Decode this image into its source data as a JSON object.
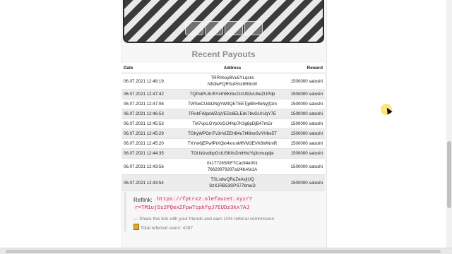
{
  "captcha": {
    "options": [
      "",
      "",
      "",
      ""
    ]
  },
  "section_title": "Recent Payouts",
  "table": {
    "headers": [
      "Date",
      "Address",
      "Reward"
    ],
    "rows": [
      {
        "date": "06.07.2021 12:48:19",
        "addr1": "TRRYeoyBVu5YLqsks",
        "addr2": "NN3wFQRSoPmz8R8cW",
        "reward": "1500000 satoshi"
      },
      {
        "date": "06.07.2021 12:47:42",
        "addr1": "TQPoiPL8U5Y4rh5Krbc2zzU92uUboZUPdp",
        "addr2": "",
        "reward": "1500000 satoshi"
      },
      {
        "date": "06.07.2021 12:47:06",
        "addr1": "TWSwCUddJNgYW9QETEETjpBhHfeNyjfj1m",
        "addr2": "",
        "reward": "1500000 satoshi"
      },
      {
        "date": "06.07.2021 12:46:53",
        "addr1": "TRohFr8peWZojVEDc6ELEdv7bvGUrUqY7E",
        "addr2": "",
        "reward": "1500000 satoshi"
      },
      {
        "date": "06.07.2021 12:45:53",
        "addr1": "TM7vjxLGYpiXrDiJ4Np7K3g8pDjB47mGr",
        "addr2": "",
        "reward": "1500000 satoshi"
      },
      {
        "date": "06.07.2021 12:45:29",
        "addr1": "TGhyWPGmTv3nViZEH84u7t48neSvYHbe5T",
        "addr2": "",
        "reward": "1500000 satoshi"
      },
      {
        "date": "06.07.2021 12:45:20",
        "addr1": "TXYw6jEPwfPtXQkr4xrunMfVM3EVK6WNmR",
        "addr2": "",
        "reward": "1500000 satoshi"
      },
      {
        "date": "06.07.2021 12:44:35",
        "addr1": "TGUidzvdbpGctUSKltsDntHbzYq3cmuqdje",
        "addr2": "",
        "reward": "1500000 satoshi"
      },
      {
        "date": "06.07.2021 12:43:56",
        "addr1": "0x17728Sf0F7Cac94e001",
        "addr2": "76629979287a1f4bAfa1A",
        "reward": "1500000 satoshi"
      },
      {
        "date": "06.07.2021 12:43:54",
        "addr1": "TSLsdwQRuZeAxjiUQ",
        "addr2": "SzXJRB53SPS77bmuD",
        "reward": "1500000 satoshi"
      }
    ]
  },
  "reflink": {
    "label": "Reflink:",
    "url_part1": "https://fptrx2.olefaucet.xyz/?",
    "url_part2": "r=TM1uj5s2PQexZFpwTcpkfgJ7EUDz3kx7AJ",
    "note": "— Share this link with your friends and earn 10% referral commission",
    "total": "Total referred users: 4287"
  },
  "colors": {
    "accent_link": "#c7254e",
    "title_gray": "#8f8f8f",
    "cursor_highlight": "#fadc50"
  }
}
